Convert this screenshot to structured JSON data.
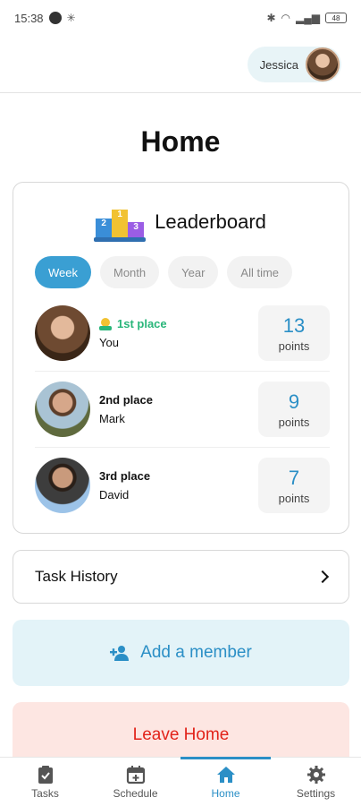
{
  "status_bar": {
    "time": "15:38",
    "battery": "48"
  },
  "header": {
    "user_name": "Jessica"
  },
  "page_title": "Home",
  "leaderboard": {
    "title": "Leaderboard",
    "tabs": [
      {
        "label": "Week",
        "active": true
      },
      {
        "label": "Month",
        "active": false
      },
      {
        "label": "Year",
        "active": false
      },
      {
        "label": "All time",
        "active": false
      }
    ],
    "rows": [
      {
        "place": "1st place",
        "name": "You",
        "points": "13",
        "points_label": "points"
      },
      {
        "place": "2nd place",
        "name": "Mark",
        "points": "9",
        "points_label": "points"
      },
      {
        "place": "3rd place",
        "name": "David",
        "points": "7",
        "points_label": "points"
      }
    ]
  },
  "task_history": {
    "label": "Task History"
  },
  "add_member": {
    "label": "Add a member"
  },
  "leave_home": {
    "label": "Leave Home"
  },
  "bottom_nav": [
    {
      "label": "Tasks",
      "icon": "clipboard-check-icon",
      "active": false
    },
    {
      "label": "Schedule",
      "icon": "calendar-add-icon",
      "active": false
    },
    {
      "label": "Home",
      "icon": "home-icon",
      "active": true
    },
    {
      "label": "Settings",
      "icon": "gear-icon",
      "active": false
    }
  ],
  "colors": {
    "accent": "#2b8fc6",
    "success": "#29b67a",
    "danger": "#e2231a"
  }
}
